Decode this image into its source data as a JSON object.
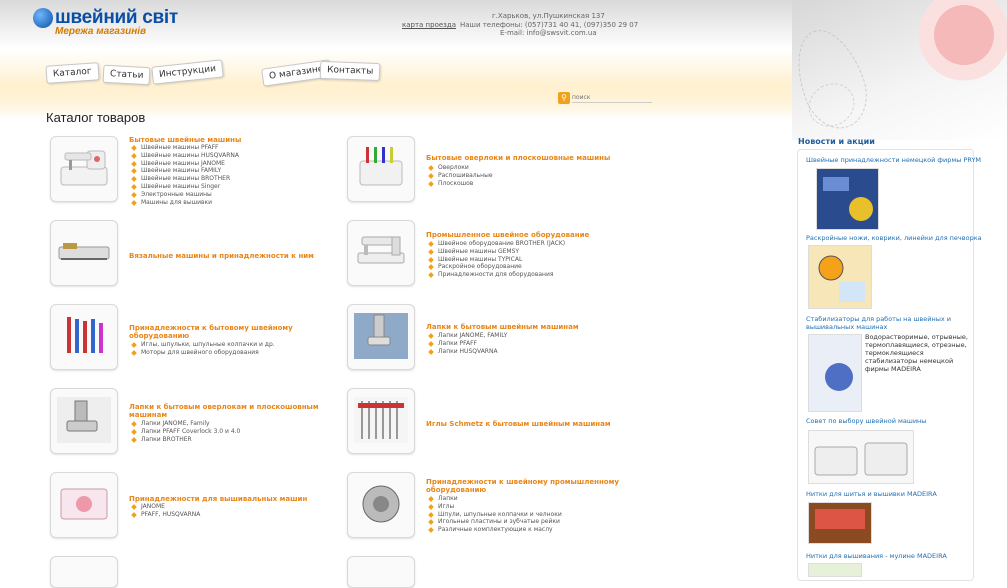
{
  "header": {
    "logo_title": "швейний світ",
    "logo_subtitle": "Мережа магазинів",
    "address": "г.Харьков, ул.Пушкинская 137",
    "map_link": "карта проезда",
    "phones": "Наши телефоны: (057)731 40 41, (097)350 29 07",
    "email": "E-mail: info@swsvit.com.ua"
  },
  "nav": {
    "items": [
      "Каталог",
      "Статьи",
      "Инструкции",
      "О магазине",
      "Контакты"
    ]
  },
  "search": {
    "placeholder": "поиск"
  },
  "catalog": {
    "title": "Каталог товаров",
    "categories": [
      {
        "title": "Бытовые швейные машины",
        "items": [
          "Швейные машины PFAFF",
          "Швейные машины HUSQVARNA",
          "Швейные машины JANOME",
          "Швейные машины FAMILY",
          "Швейные машины BROTHER",
          "Швейные машины Singer",
          "Электронные машины",
          "Машины для вышивки"
        ]
      },
      {
        "title": "Бытовые оверлоки и плоскошовные машины",
        "items": [
          "Оверлоки",
          "Распошивальные",
          "Плоскошов"
        ]
      },
      {
        "title": "Вязальные машины и принадлежности к ним",
        "items": []
      },
      {
        "title": "Промышленное швейное оборудование",
        "items": [
          "Швейное оборудование BROTHER (JACK)",
          "Швейные машины GEMSY",
          "Швейные машины TYPICAL",
          "Раскройное оборудование",
          "Принадлежности для оборудования"
        ]
      },
      {
        "title": "Принадлежности к бытовому швейному оборудованию",
        "items": [
          "Иглы, шпульки, шпульные колпачки и др.",
          "Моторы для швейного оборудования"
        ]
      },
      {
        "title": "Лапки к бытовым швейным машинам",
        "items": [
          "Лапки JANOME, FAMILY",
          "Лапки PFAFF",
          "Лапки HUSQVARNA"
        ]
      },
      {
        "title": "Лапки к бытовым оверлокам и плоскошовным машинам",
        "items": [
          "Лапки JANOME, Family",
          "Лапки PFAFF Coverlock 3.0 и 4.0",
          "Лапки BROTHER"
        ]
      },
      {
        "title": "Иглы Schmetz к бытовым швейным машинам",
        "items": []
      },
      {
        "title": "Принадлежности для вышивальных машин",
        "items": [
          "JANOME",
          "PFAFF, HUSQVARNA"
        ]
      },
      {
        "title": "Принадлежности к швейному промышленному оборудованию",
        "items": [
          "Лапки",
          "Иглы",
          "Шпули, шпульные колпачки и челноки",
          "Игольные пластины и зубчатые рейки",
          "Различные комплектующие к маслу"
        ]
      }
    ]
  },
  "news": {
    "title": "Новости и акции",
    "items": [
      {
        "title": "Швейные принадлежности немецкой фирмы PRYM"
      },
      {
        "title": "Раскройные ножи, коврики, линейки для печворка"
      },
      {
        "title": "Стабилизаторы для работы на швейных и",
        "title2": "вышивальных машинах",
        "desc": [
          "Водорастворимые, отрывные,",
          "термоплавящиеся, отрезные,",
          "термоклеящиеся",
          "стабилизаторы немецкой",
          "фирмы MADEIRA"
        ]
      },
      {
        "title": "Совет по выбору швейной машины"
      },
      {
        "title": "Нитки для шитья и вышивки MADEIRA"
      },
      {
        "title": "Нитки для вышивания - мулине MADEIRA"
      }
    ]
  },
  "colors": {
    "accent": "#e8861a",
    "link": "#1f6fb4",
    "brand": "#0a4fa6"
  }
}
